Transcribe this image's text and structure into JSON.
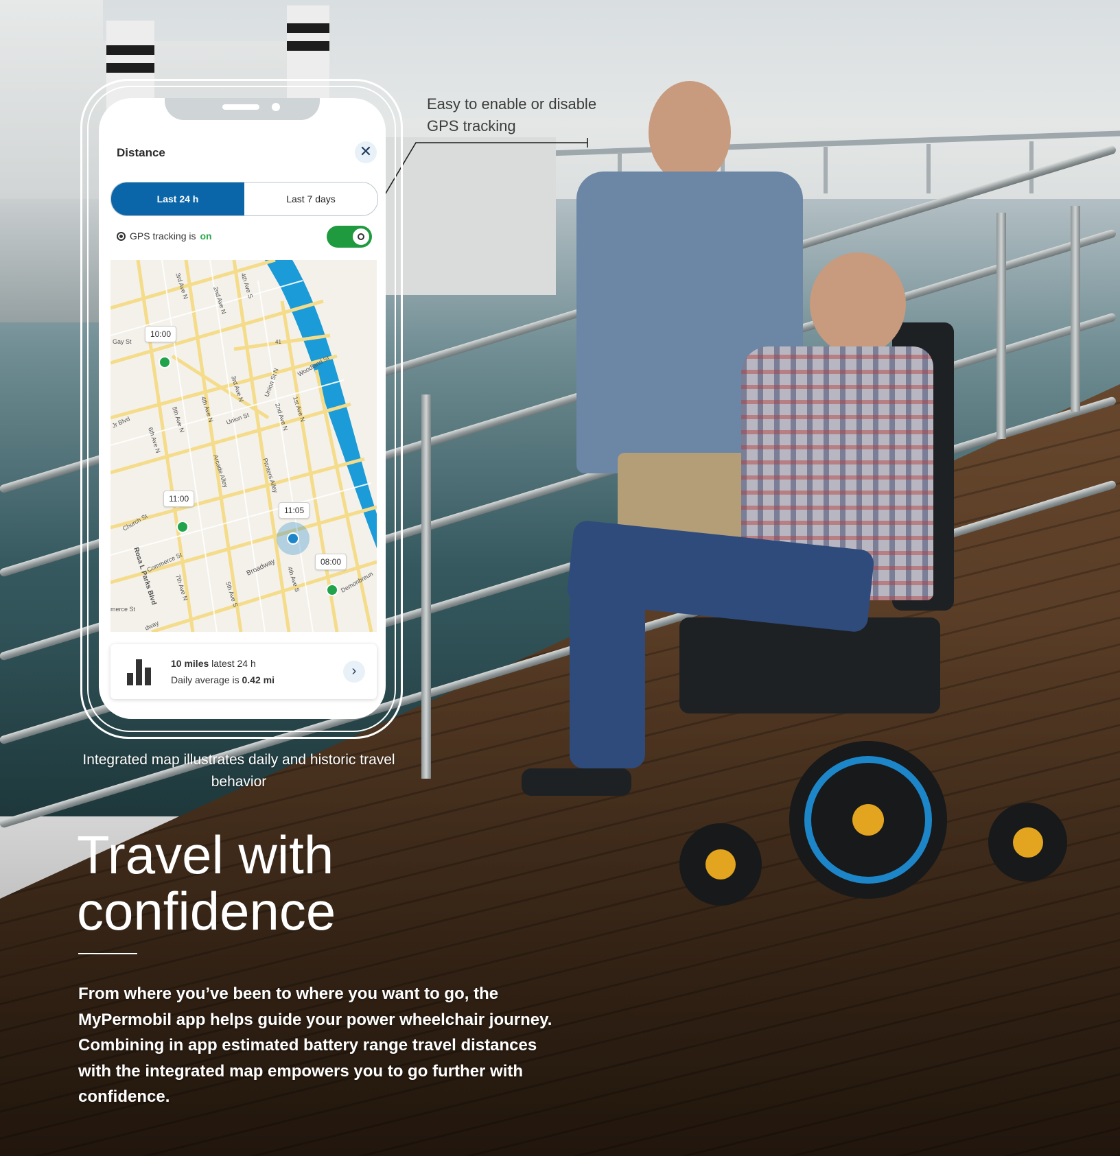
{
  "colors": {
    "brand_blue": "#0a66a8",
    "toggle_green": "#1f9a3f",
    "pin_green": "#21a34c",
    "water_blue": "#1d86c9"
  },
  "callouts": {
    "gps": "Easy to enable or disable GPS tracking",
    "map": "Integrated map illustrates daily and historic travel behavior"
  },
  "app": {
    "title": "Distance",
    "close_icon": "close-icon",
    "tabs": [
      {
        "label": "Last 24 h",
        "active": true
      },
      {
        "label": "Last 7 days",
        "active": false
      }
    ],
    "gps": {
      "prefix": "GPS tracking is",
      "status": "on",
      "toggle_on": true
    },
    "map": {
      "streets": [
        "3rd Ave N",
        "2nd Ave N",
        "4th Ave S",
        "Gay St",
        "Woodland St",
        "Union St N",
        "1st Ave N",
        "2nd Ave N",
        "3rd Ave N",
        "4th Ave N",
        "5th Ave N",
        "Union St",
        "Jr Blvd",
        "6th Ave N",
        "Arcade Alley",
        "Printers Alley",
        "Church St",
        "Rosa L Parks Blvd",
        "Commerce St",
        "7th Ave N",
        "Broadway",
        "4th Ave S",
        "5th Ave S",
        "Demonbreun",
        "merce St",
        "dway",
        "41"
      ],
      "pins": [
        {
          "time": "10:00"
        },
        {
          "time": "11:00"
        },
        {
          "time": "11:05"
        },
        {
          "time": "08:00"
        }
      ]
    },
    "summary": {
      "distance_bold": "10 miles",
      "distance_rest": "latest 24 h",
      "avg_prefix": "Daily average is",
      "avg_value": "0.42 mi"
    }
  },
  "headline": {
    "line1": "Travel with",
    "line2": "confidence"
  },
  "body": "From where you’ve been to where you want to go, the MyPermobil app helps guide your power wheelchair journey. Combining in app estimated battery range travel distances with the integrated map empowers you to go further with confidence."
}
